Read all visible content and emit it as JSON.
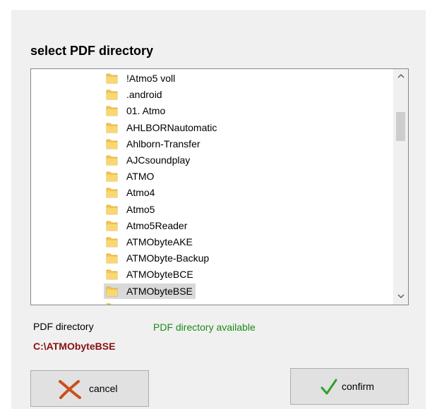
{
  "dialog": {
    "title": "select PDF directory",
    "folders": [
      {
        "label": "!Atmo5 voll"
      },
      {
        "label": ".android"
      },
      {
        "label": "01. Atmo"
      },
      {
        "label": "AHLBORNautomatic"
      },
      {
        "label": "Ahlborn-Transfer"
      },
      {
        "label": "AJCsoundplay"
      },
      {
        "label": "ATMO"
      },
      {
        "label": "Atmo4"
      },
      {
        "label": "Atmo5"
      },
      {
        "label": "Atmo5Reader"
      },
      {
        "label": "ATMObyteAKE"
      },
      {
        "label": "ATMObyte-Backup"
      },
      {
        "label": "ATMObyteBCE"
      },
      {
        "label": "ATMObyteBSE",
        "selected": true
      }
    ],
    "scroll_up_icon": "chevron-up-icon",
    "scroll_down_icon": "chevron-down-icon",
    "folder_icon": "folder-icon",
    "folder_color": "#f5c84c",
    "path_label": "PDF directory",
    "path_value": "C:\\ATMObyteBSE",
    "path_value_color": "#8b1010",
    "status_text": "PDF directory available",
    "status_color": "#1a8a1a",
    "cancel_label": "cancel",
    "cancel_icon": "x-icon",
    "cancel_icon_color": "#c8501e",
    "confirm_label": "confirm",
    "confirm_icon": "checkmark-icon",
    "confirm_icon_color": "#2ea02e"
  }
}
